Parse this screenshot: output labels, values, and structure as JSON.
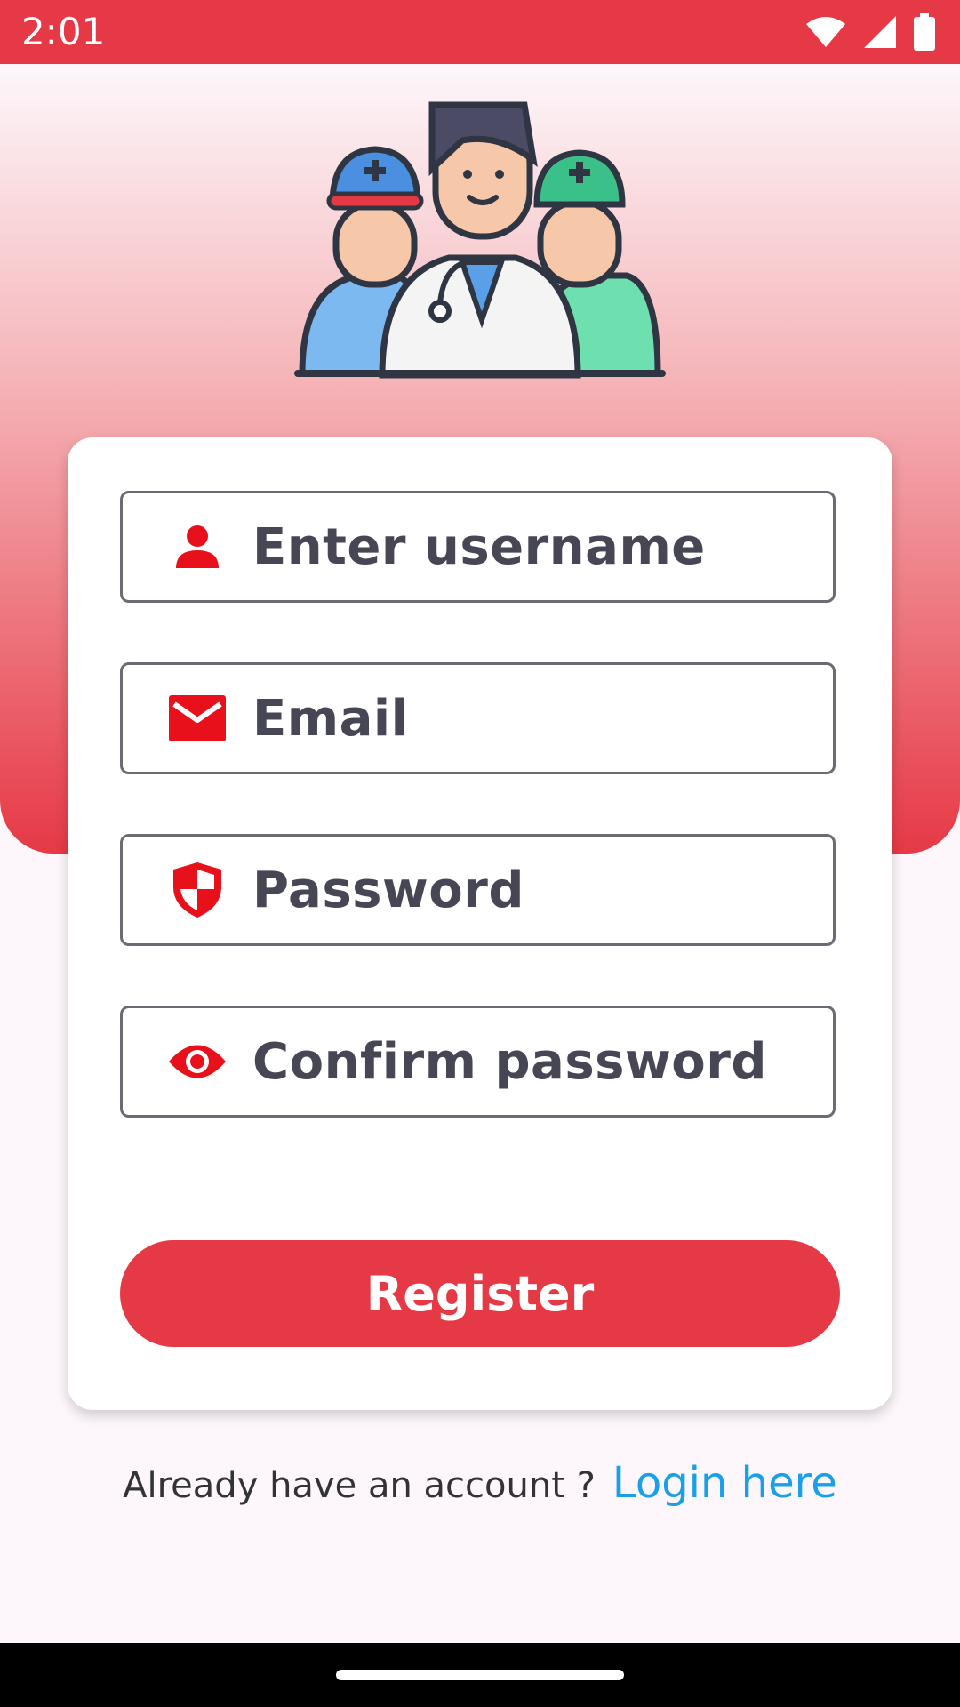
{
  "status": {
    "time": "2:01"
  },
  "form": {
    "username_placeholder": "Enter username",
    "email_placeholder": "Email",
    "password_placeholder": "Password",
    "confirm_placeholder": "Confirm password",
    "register_label": "Register"
  },
  "footer": {
    "prefix": "Already have an account ?",
    "link": "Login here"
  },
  "icons": {
    "username": "person-icon",
    "email": "mail-icon",
    "password": "shield-icon",
    "confirm": "eye-icon"
  },
  "colors": {
    "brand": "#e63946",
    "icon": "#e8101a",
    "link": "#1aa0e8",
    "field_text": "#464655"
  }
}
